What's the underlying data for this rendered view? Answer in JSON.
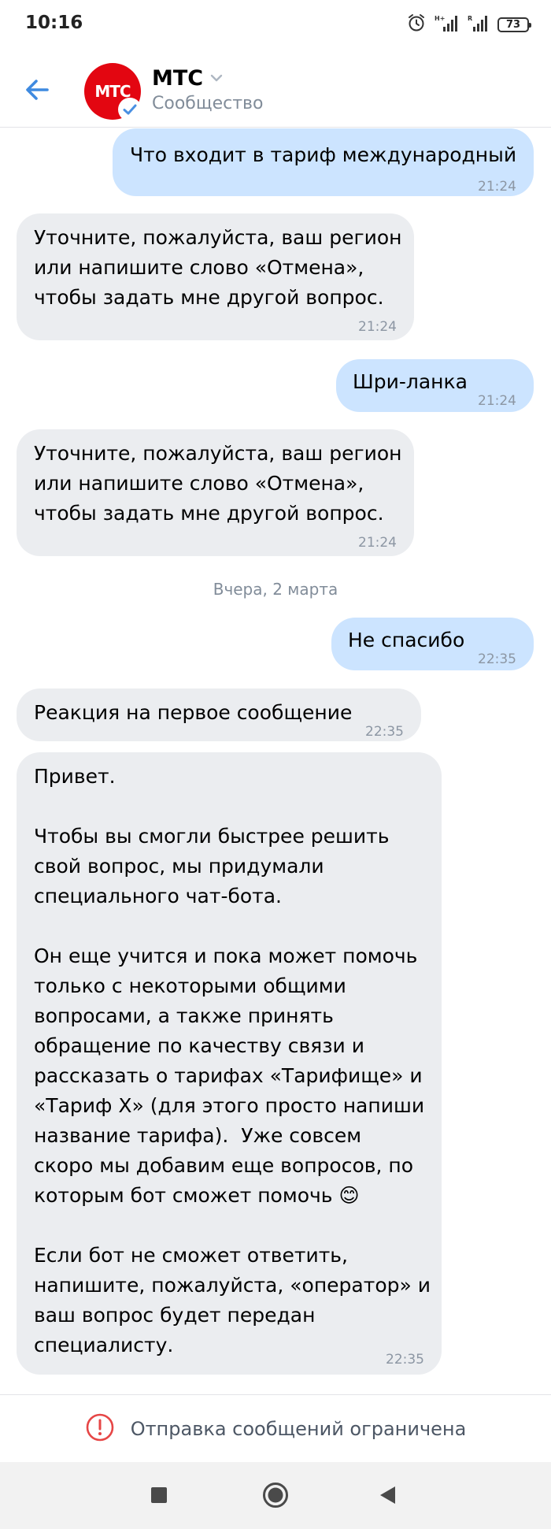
{
  "status_bar": {
    "time": "10:16",
    "battery": "73"
  },
  "header": {
    "avatar_text": "МТС",
    "title": "МТС",
    "subtitle": "Сообщество",
    "brand_color": "#e30611"
  },
  "messages": [
    {
      "dir": "out",
      "text": "Что входит в тариф международный",
      "time": "21:24"
    },
    {
      "dir": "in",
      "text": "Уточните, пожалуйста, ваш регион\nили напишите слово «Отмена»,\nчтобы задать мне другой вопрос.",
      "time": "21:24"
    },
    {
      "dir": "out",
      "text": "Шри-ланка",
      "time": "21:24"
    },
    {
      "dir": "in",
      "text": "Уточните, пожалуйста, ваш регион\nили напишите слово «Отмена»,\nчтобы задать мне другой вопрос.",
      "time": "21:24"
    },
    {
      "dir": "out",
      "text": "Не спасибо",
      "time": "22:35"
    },
    {
      "dir": "in",
      "text": "Реакция на первое сообщение",
      "time": "22:35"
    },
    {
      "dir": "in",
      "text": "Привет.\n\nЧтобы вы смогли быстрее решить\nсвой вопрос, мы придумали\nспециального чат-бота.\n\nОн еще учится и пока может помочь\nтолько с некоторыми общими\nвопросами, а также принять\nобращение по качеству связи и\nрассказать о тарифах «Тарифище» и\n«Тариф Х» (для этого просто напиши\nназвание тарифа).  Уже совсем\nскоро мы добавим еще вопросов, по\nкоторым бот сможет помочь 😊\n\nЕсли бот не сможет ответить,\nнапишите, пожалуйста, «оператор» и\nваш вопрос будет передан\nспециалисту.",
      "time": "22:35"
    }
  ],
  "date_separator": "Вчера, 2 марта",
  "restriction": {
    "text": "Отправка сообщений ограничена",
    "icon": "alert-circle-icon",
    "color": "#e64646"
  },
  "colors": {
    "accent": "#3f8ae0",
    "outgoing_bubble": "#cce4ff",
    "incoming_bubble": "#ebedf0"
  }
}
